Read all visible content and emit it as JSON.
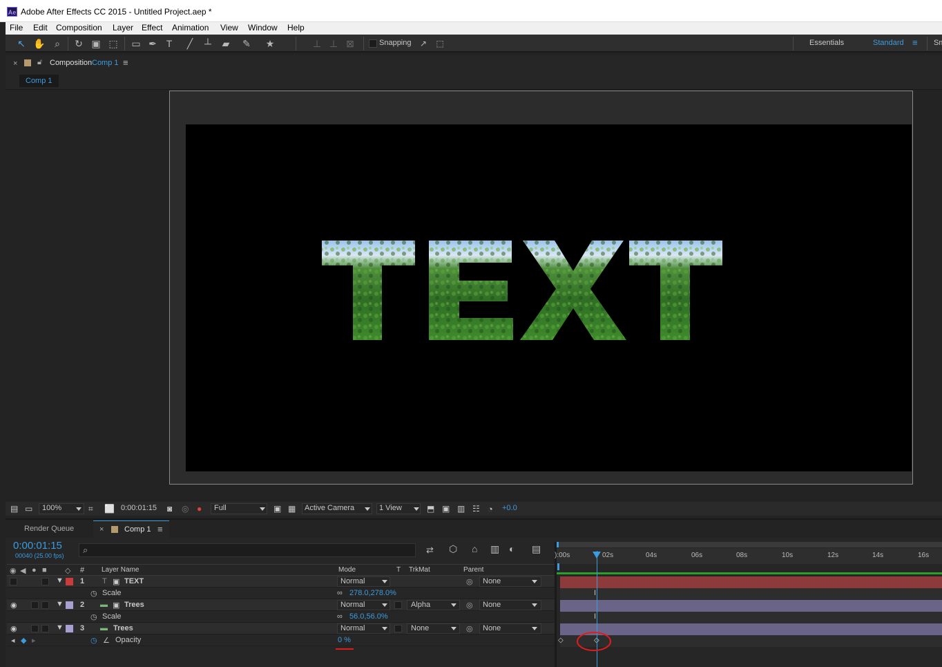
{
  "window": {
    "title": "Adobe After Effects CC 2015 - Untitled Project.aep *",
    "logo_text": "Ae"
  },
  "menu": [
    "File",
    "Edit",
    "Composition",
    "Layer",
    "Effect",
    "Animation",
    "View",
    "Window",
    "Help"
  ],
  "toolbar": {
    "snapping_label": "Snapping",
    "workspaces": [
      "Essentials",
      "Standard",
      "Sm"
    ],
    "active_workspace": "Standard"
  },
  "composition_panel": {
    "tab_prefix": "Composition",
    "tab_comp": "Comp 1",
    "subtab": "Comp 1",
    "canvas_text": "TEXT"
  },
  "viewer_bar": {
    "zoom": "100%",
    "timecode": "0:00:01:15",
    "resolution": "Full",
    "camera": "Active Camera",
    "views": "1 View",
    "exposure": "+0.0"
  },
  "timeline": {
    "tabs": [
      "Render Queue",
      "Comp 1"
    ],
    "timecode": "0:00:01:15",
    "frame_info": "00040 (25.00 fps)",
    "search_placeholder": "",
    "columns": {
      "num": "#",
      "layer_name": "Layer Name",
      "mode": "Mode",
      "t": "T",
      "trkmat": "TrkMat",
      "parent": "Parent"
    },
    "ruler": [
      "):00s",
      "02s",
      "04s",
      "06s",
      "08s",
      "10s",
      "12s",
      "14s",
      "16s"
    ],
    "layers": [
      {
        "num": "1",
        "name": "TEXT",
        "mode": "Normal",
        "trkmat": "",
        "parent": "None",
        "label_color": "#c83c3c",
        "prop": "Scale",
        "prop_value": "278.0,278.0%"
      },
      {
        "num": "2",
        "name": "Trees",
        "mode": "Normal",
        "trkmat": "Alpha",
        "parent": "None",
        "label_color": "#a8a0d0",
        "prop": "Scale",
        "prop_value": "56.0,56.0%"
      },
      {
        "num": "3",
        "name": "Trees",
        "mode": "Normal",
        "trkmat": "None",
        "parent": "None",
        "label_color": "#a8a0d0",
        "prop": "Opacity",
        "prop_value": "0 %"
      }
    ]
  },
  "colors": {
    "accent": "#3c9ce0",
    "text_layer_bar": "#8c3a3a",
    "trees_layer_bar": "#6a6488",
    "annotation": "#e01c1c"
  }
}
